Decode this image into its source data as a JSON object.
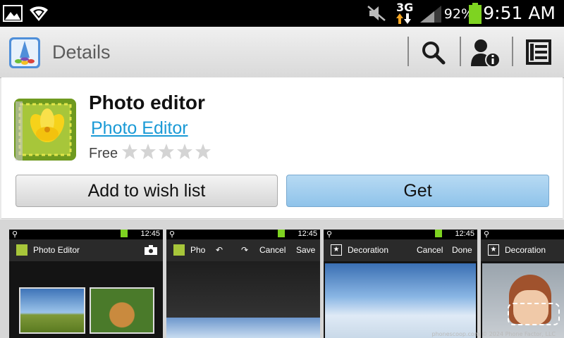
{
  "status_bar": {
    "network_label": "3G",
    "battery_percent": "92%",
    "time": "9:51 AM",
    "icons": [
      "gallery-icon",
      "wifi-icon",
      "mute-icon",
      "data-arrows-icon",
      "signal-icon",
      "battery-icon"
    ]
  },
  "action_bar": {
    "title": "Details",
    "icons": [
      "samsung-apps-icon",
      "search-icon",
      "account-info-icon",
      "menu-list-icon"
    ]
  },
  "app": {
    "name": "Photo editor",
    "developer": "Photo Editor",
    "price": "Free",
    "rating_stars": 0,
    "max_stars": 5
  },
  "buttons": {
    "wish_list": "Add to wish list",
    "get": "Get"
  },
  "screenshots": [
    {
      "status_time": "12:45",
      "title": "Photo Editor",
      "actions": []
    },
    {
      "status_time": "12:45",
      "title": "Pho",
      "actions": [
        "Cancel",
        "Save"
      ]
    },
    {
      "status_time": "12:45",
      "title": "Decoration",
      "actions": [
        "Cancel",
        "Done"
      ]
    },
    {
      "status_time": "12:45",
      "title": "Decoration",
      "actions": []
    }
  ],
  "watermark": "phonescoop.com  © 2024 Phone Factor, LLC",
  "colors": {
    "link": "#1a9ad6",
    "get_button": "#9ccbee",
    "battery": "#7ed321"
  }
}
